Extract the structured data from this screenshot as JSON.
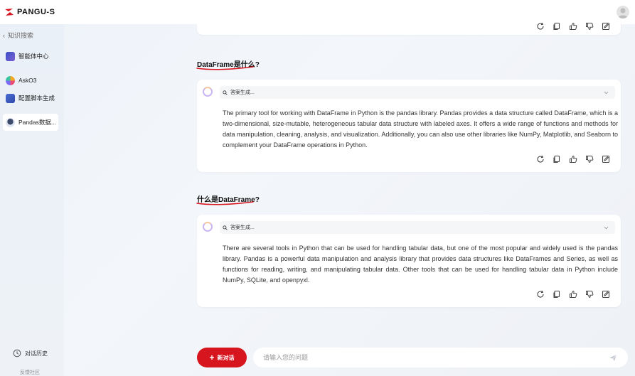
{
  "app": {
    "brand": "PANGU-S"
  },
  "sidebar": {
    "back_label": "知识搜索",
    "items": [
      {
        "label": "智能体中心"
      },
      {
        "label": "AskO3"
      },
      {
        "label": "配置脚本生成"
      },
      {
        "label": "Pandas数据..."
      }
    ],
    "history_label": "对话历史",
    "feedback_label": "反馈社区"
  },
  "conversation": [
    {
      "question": "DataFrame是什么?",
      "status": "答案生成...",
      "answer": "The primary tool for working with DataFrame in Python is the pandas library. Pandas provides a data structure called DataFrame, which is a two-dimensional, size-mutable, heterogeneous tabular data structure with labeled axes. It offers a wide range of functions and methods for data manipulation, cleaning, analysis, and visualization. Additionally, you can also use other libraries like NumPy, Matplotlib, and Seaborn to complement your DataFrame operations in Python."
    },
    {
      "question": "什么是DataFrame?",
      "status": "答案生成...",
      "answer": "There are several tools in Python that can be used for handling tabular data, but one of the most popular and widely used is the pandas library. Pandas is a powerful data manipulation and analysis library that provides data structures like DataFrames and Series, as well as functions for reading, writing, and manipulating tabular data. Other tools that can be used for handling tabular data in Python include NumPy, SQLite, and openpyxl."
    }
  ],
  "composer": {
    "new_chat_label": "新对话",
    "placeholder": "请输入您的问题"
  },
  "colors": {
    "accent": "#d7151f",
    "background": "#eef3f9"
  },
  "icons": [
    "refresh-icon",
    "copy-icon",
    "thumbs-up-icon",
    "thumbs-down-icon",
    "edit-icon",
    "send-icon",
    "search-icon",
    "chevron-down-icon",
    "history-icon",
    "plus-icon"
  ]
}
